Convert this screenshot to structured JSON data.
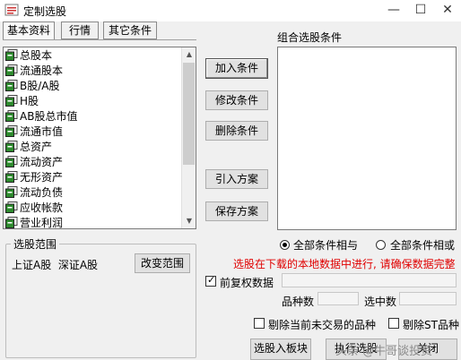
{
  "window": {
    "title": "定制选股",
    "minimize": "—",
    "maximize": "☐",
    "close": "✕"
  },
  "tabs": [
    "基本资料",
    "行情",
    "其它条件"
  ],
  "indicator_list": [
    "总股本",
    "流通股本",
    "B股/A股",
    "H股",
    "AB股总市值",
    "流通市值",
    "总资产",
    "流动资产",
    "无形资产",
    "流动负债",
    "应收帐款",
    "营业利润"
  ],
  "buttons": {
    "add": "加入条件",
    "modify": "修改条件",
    "delete": "删除条件",
    "import": "引入方案",
    "save": "保存方案",
    "change_range": "改变范围",
    "to_block": "选股入板块",
    "execute": "执行选股",
    "close": "关闭"
  },
  "combo": {
    "label": "组合选股条件"
  },
  "range": {
    "title": "选股范围",
    "text": "上证A股  深证A股"
  },
  "logic": {
    "and_label": "全部条件相与",
    "or_label": "全部条件相或",
    "selected": "and"
  },
  "notice": "选股在下载的本地数据中进行, 请确保数据完整",
  "adjust": {
    "label": "前复权数据",
    "checked": true
  },
  "counts": {
    "total_label": "品种数",
    "selected_label": "选中数"
  },
  "filters": {
    "untraded_label": "剔除当前未交易的品种",
    "st_label": "剔除ST品种"
  },
  "watermark": "头条 @牛哥谈投资",
  "colors": {
    "notice": "#e00000",
    "icon_green": "#2e8b2e"
  }
}
